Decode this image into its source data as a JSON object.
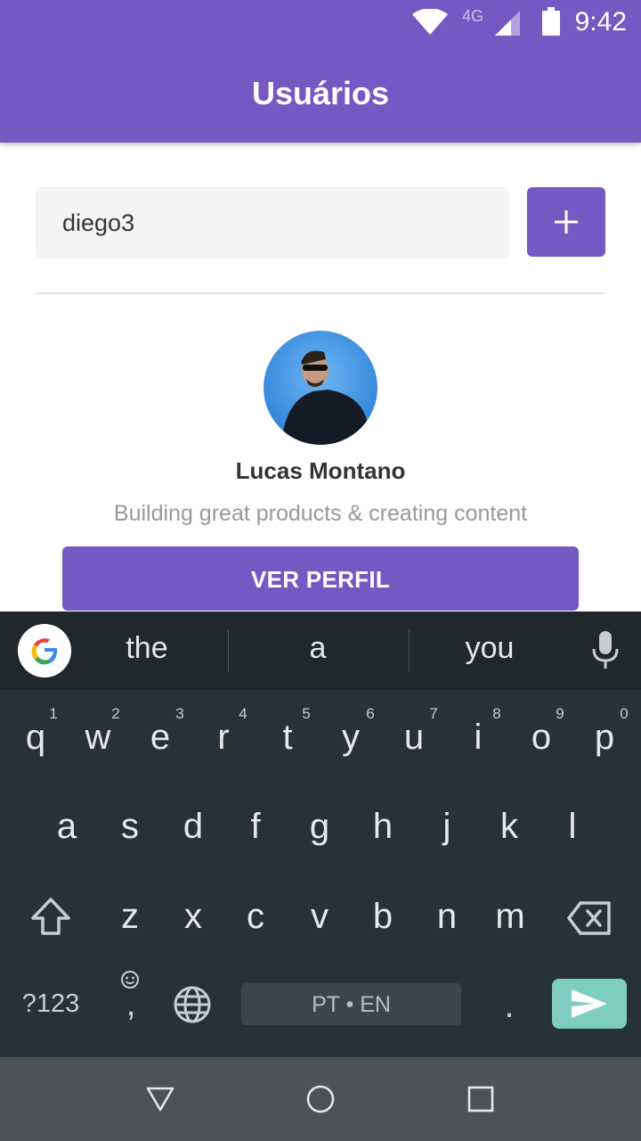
{
  "status_bar": {
    "time": "9:42",
    "network": "4G",
    "icons": [
      "wifi-icon",
      "signal-icon",
      "battery-icon"
    ]
  },
  "app_bar": {
    "title": "Usuários",
    "color": "#7559c2"
  },
  "search": {
    "value": "diego3",
    "add_icon": "plus-icon"
  },
  "profile": {
    "name": "Lucas Montano",
    "bio": "Building great products & creating content",
    "button_label": "VER PERFIL"
  },
  "keyboard": {
    "suggestions": [
      "the",
      "a",
      "you"
    ],
    "rows": {
      "row1": [
        "q",
        "w",
        "e",
        "r",
        "t",
        "y",
        "u",
        "i",
        "o",
        "p"
      ],
      "row1_hints": [
        "1",
        "2",
        "3",
        "4",
        "5",
        "6",
        "7",
        "8",
        "9",
        "0"
      ],
      "row2": [
        "a",
        "s",
        "d",
        "f",
        "g",
        "h",
        "j",
        "k",
        "l"
      ],
      "row3": [
        "z",
        "x",
        "c",
        "v",
        "b",
        "n",
        "m"
      ]
    },
    "symbols_key": "?123",
    "comma_key": ",",
    "period_key": ".",
    "space_label": "PT • EN",
    "accent_color": "#7fcdc1"
  },
  "nav_bar": {
    "icons": [
      "back-icon",
      "home-icon",
      "recents-icon"
    ]
  }
}
